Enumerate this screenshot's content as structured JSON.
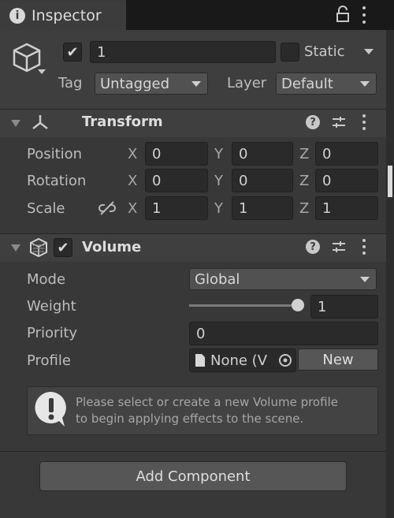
{
  "tab": {
    "title": "Inspector",
    "icon": "info-icon"
  },
  "gameobject": {
    "active_check": "✔",
    "name": "1",
    "static_label": "Static",
    "tag_label": "Tag",
    "tag_value": "Untagged",
    "layer_label": "Layer",
    "layer_value": "Default"
  },
  "transform": {
    "title": "Transform",
    "rows": [
      {
        "label": "Position",
        "x": "0",
        "y": "0",
        "z": "0"
      },
      {
        "label": "Rotation",
        "x": "0",
        "y": "0",
        "z": "0"
      },
      {
        "label": "Scale",
        "x": "1",
        "y": "1",
        "z": "1"
      }
    ],
    "axes": {
      "x": "X",
      "y": "Y",
      "z": "Z"
    }
  },
  "volume": {
    "title": "Volume",
    "enabled_check": "✔",
    "mode_label": "Mode",
    "mode_value": "Global",
    "weight_label": "Weight",
    "weight_value": "1",
    "weight_fraction": 1.0,
    "priority_label": "Priority",
    "priority_value": "0",
    "profile_label": "Profile",
    "profile_value": "None (V",
    "new_button": "New",
    "help_line1": "Please select or create a new Volume profile",
    "help_line2": "to begin applying effects to the scene."
  },
  "add_component": "Add Component",
  "colors": {
    "background": "#383838",
    "header": "#3f3f3f",
    "field": "#2a2a2a"
  }
}
